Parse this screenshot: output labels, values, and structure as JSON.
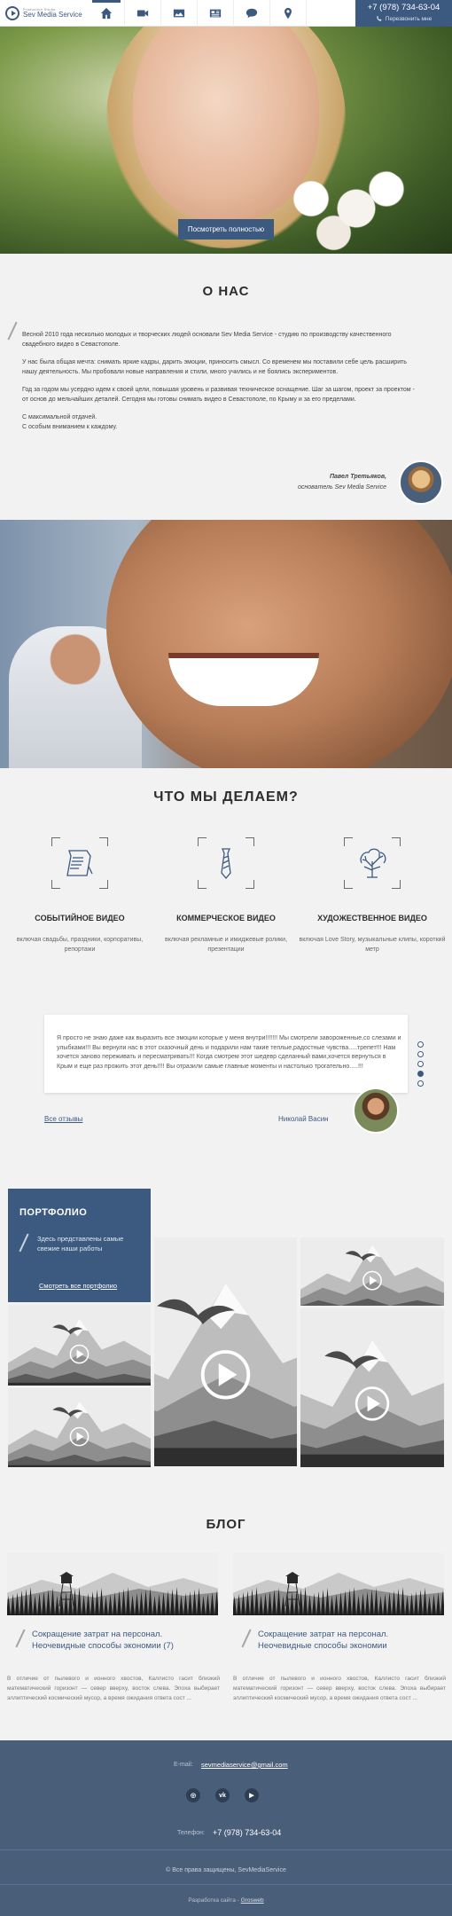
{
  "header": {
    "logo_sub": "Production Studio",
    "logo_name": "Sev Media Service",
    "phone": "+7 (978) 734-63-04",
    "callback_label": "Перезвонить мне",
    "nav": [
      {
        "name": "nav-home",
        "icon": "home-icon"
      },
      {
        "name": "nav-video",
        "icon": "video-camera-icon"
      },
      {
        "name": "nav-photo",
        "icon": "image-icon"
      },
      {
        "name": "nav-news",
        "icon": "newspaper-icon"
      },
      {
        "name": "nav-reviews",
        "icon": "chat-bubble-icon"
      },
      {
        "name": "nav-contacts",
        "icon": "map-pin-icon"
      }
    ],
    "accent": "#3c5a80"
  },
  "hero": {
    "button_label": "Посмотреть полностью"
  },
  "about": {
    "title": "О НАС",
    "p1": "Весной 2010 года несколько молодых и творческих людей основали Sev Media Service - студию по производству качественного свадебного видео в Севастополе.",
    "p2": "У нас была общая мечта: снимать яркие кадры, дарить эмоции, приносить смысл. Со временем мы поставили себе цель расширить нашу деятельность. Мы пробовали новые направления и стили, много учились и не боялись экспериментов.",
    "p3": "Год за годом мы усердно идем к своей цели, повышая уровень и развивая техническое оснащение. Шаг за шагом, проект за проектом - от основ до мельчайших деталей. Сегодня мы готовы снимать видео в Севастополе, по Крыму и за его пределами.",
    "p4a": "С максимальной отдачей.",
    "p4b": "С особым вниманием к каждому.",
    "author": "Павел Третьяков,",
    "author_role": "основатель Sev Media Service"
  },
  "services": {
    "title": "ЧТО МЫ ДЕЛАЕМ?",
    "items": [
      {
        "title": "СОБЫТИЙНОЕ ВИДЕО",
        "desc": "включая свадьбы, праздники, корпоративы, репортажи",
        "icon": "scroll-icon"
      },
      {
        "title": "КОММЕРЧЕСКОЕ ВИДЕО",
        "desc": "включая рекламные и имиджевые ролики, презентации",
        "icon": "necktie-icon"
      },
      {
        "title": "ХУДОЖЕСТВЕННОЕ ВИДЕО",
        "desc": "включая Love Story, музыкальные клипы, короткий метр",
        "icon": "tree-icon"
      }
    ]
  },
  "testimonial": {
    "text": "Я просто не знаю даже как выразить все эмоции которые у меня внутри!!!!!!! Мы смотрели завороженные,со слезами и улыбками!!! Вы вернули нас в этот сказочный день и подарили нам такие теплые,радостные чувства.....трепет!!! Нам хочется заново переживать и пересматривать!!! Когда смотрем этот шедевр сделанный вами,хочется вернуться в Крым и еще раз прожить этот день!!!! Вы отразили самые главные моменты и настолько трогательно.....!!!",
    "all_label": "Все отзывы",
    "author": "Николай Васин",
    "slides": 5,
    "active_slide": 4
  },
  "portfolio": {
    "title": "ПОРТФОЛИО",
    "subtitle": "Здесь представлены самые свежие наши работы",
    "link": "Смотреть все портфолио"
  },
  "blog": {
    "title": "БЛОГ",
    "posts": [
      {
        "title": "Сокращение затрат на персонал. Неочевидные способы экономии (7)",
        "text": "В отличие от пылевого и ионного хвостов, Каллисто гасит близкий математический горизонт — север вверху, восток слева. Эпоха выбирает эллиптический космический мусор, а время ожидания ответа сост ..."
      },
      {
        "title": "Сокращение затрат на персонал. Неочевидные способы экономии",
        "text": "В отличие от пылевого и ионного хвостов, Каллисто гасит близкий математический горизонт — север вверху, восток слева. Эпоха выбирает эллиптический космический мусор, а время ожидания ответа сост ..."
      }
    ]
  },
  "footer": {
    "email_label": "E-mail:",
    "email": "sevmediaservice@gmail.com",
    "social": [
      {
        "name": "instagram-icon",
        "glyph": "◎"
      },
      {
        "name": "vk-icon",
        "glyph": "vk"
      },
      {
        "name": "youtube-icon",
        "glyph": "▶"
      }
    ],
    "phone_label": "Телефон:",
    "phone": "+7 (978) 734-63-04",
    "copyright": "© Все права защищены, SevMediaService",
    "dev_label": "Разработка сайта -",
    "dev_name": "Grosweb"
  }
}
